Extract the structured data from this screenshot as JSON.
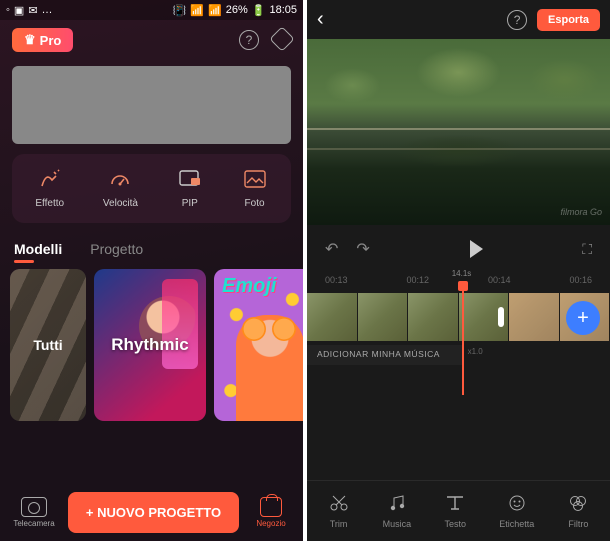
{
  "status": {
    "time": "18:05",
    "battery": "26%"
  },
  "left": {
    "pro_label": "Pro",
    "tools": [
      {
        "label": "Effetto"
      },
      {
        "label": "Velocità"
      },
      {
        "label": "PIP"
      },
      {
        "label": "Foto"
      }
    ],
    "tabs": {
      "models": "Modelli",
      "project": "Progetto"
    },
    "templates": [
      {
        "label": "Tutti"
      },
      {
        "label": "Rhythmic"
      },
      {
        "label": "Emoji"
      }
    ],
    "camera_label": "Telecamera",
    "new_project": "+  NUOVO PROGETTO",
    "shop_label": "Negozio"
  },
  "right": {
    "export": "Esporta",
    "watermark": "filmora Go",
    "times": [
      "00:13",
      "00:12",
      "00:14",
      "00:16"
    ],
    "playhead_label": "14.1s",
    "speed_label": "x1.0",
    "music_track": "ADICIONAR MINHA MÚSICA",
    "tools": [
      {
        "label": "Trim"
      },
      {
        "label": "Musica"
      },
      {
        "label": "Testo"
      },
      {
        "label": "Etichetta"
      },
      {
        "label": "Filtro"
      }
    ]
  }
}
